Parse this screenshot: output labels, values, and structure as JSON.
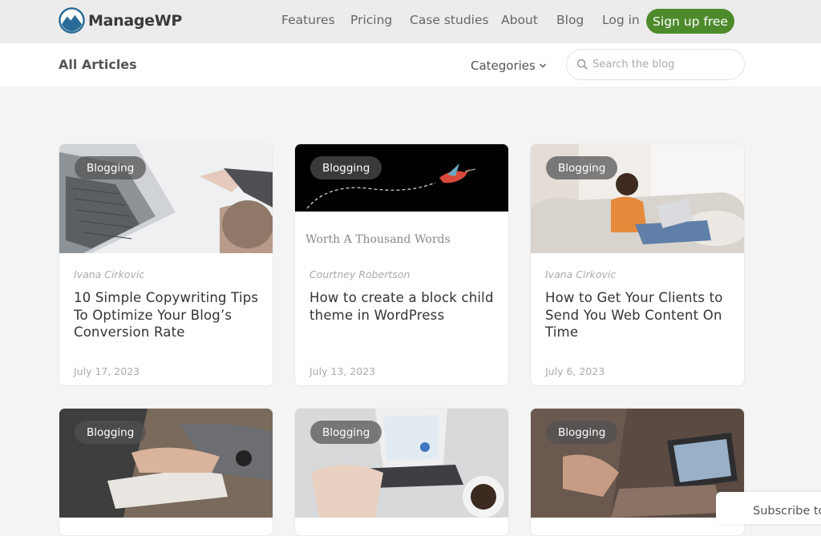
{
  "brand": {
    "name": "ManageWP"
  },
  "nav": {
    "items": [
      "Features",
      "Pricing",
      "Case studies",
      "About",
      "Blog",
      "Log in"
    ],
    "signup_label": "Sign up free"
  },
  "subheader": {
    "title": "All Articles",
    "categories_label": "Categories",
    "search_placeholder": "Search the blog"
  },
  "colors": {
    "accent": "#4d8a2c",
    "badge": "#505050"
  },
  "cards": [
    {
      "category": "Blogging",
      "author": "Ivana Cirkovic",
      "title": "10 Simple Copywriting Tips To Optimize Your Blog’s Conversion Rate",
      "date": "July 17, 2023",
      "image": "laptop-and-hands-writing"
    },
    {
      "category": "Blogging",
      "author": "Courtney Robertson",
      "title": "How to create a block child theme in WordPress",
      "date": "July 13, 2023",
      "image": "hummingbird-illustration",
      "image_caption": "Worth A Thousand Words"
    },
    {
      "category": "Blogging",
      "author": "Ivana Cirkovic",
      "title": "How to Get Your Clients to Send You Web Content On Time",
      "date": "July 6, 2023",
      "image": "woman-on-sofa-with-laptop"
    },
    {
      "category": "Blogging",
      "image": "hands-writing-at-desk"
    },
    {
      "category": "Blogging",
      "image": "laptop-with-charts"
    },
    {
      "category": "Blogging",
      "image": "person-talking-at-laptop"
    }
  ],
  "subscribe": {
    "label": "Subscribe to"
  }
}
